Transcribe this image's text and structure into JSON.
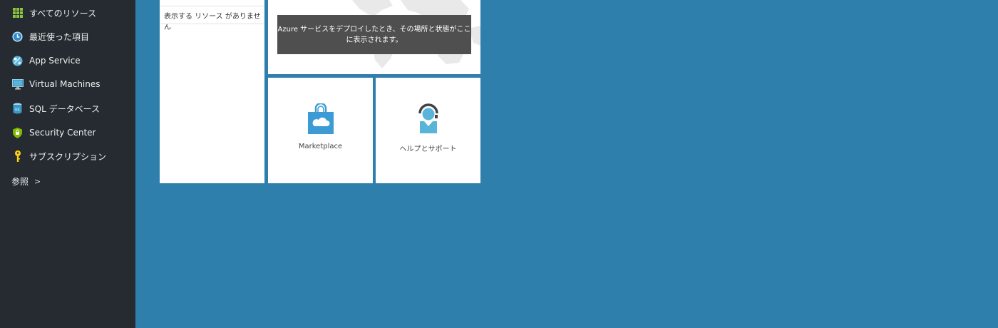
{
  "sidebar": {
    "items": [
      {
        "label": "すべてのリソース",
        "icon": "grid-icon"
      },
      {
        "label": "最近使った項目",
        "icon": "clock-icon"
      },
      {
        "label": "App Service",
        "icon": "app-service-icon"
      },
      {
        "label": "Virtual Machines",
        "icon": "monitor-icon"
      },
      {
        "label": "SQL データベース",
        "icon": "sql-database-icon"
      },
      {
        "label": "Security Center",
        "icon": "shield-icon"
      },
      {
        "label": "サブスクリプション",
        "icon": "key-icon"
      }
    ],
    "browse_label": "参照",
    "browse_chevron": ">"
  },
  "resources_tile": {
    "empty_text": "表示する リソース がありません"
  },
  "map_tile": {
    "message": "Azure サービスをデプロイしたとき、その場所と状態がここに表示されます。"
  },
  "marketplace_tile": {
    "label": "Marketplace",
    "icon": "shopping-bag-icon"
  },
  "help_tile": {
    "label": "ヘルプとサポート",
    "icon": "support-agent-icon"
  },
  "colors": {
    "sidebar_bg": "#252b31",
    "canvas_bg": "#2f7fad",
    "tile_bg": "#ffffff",
    "accent_blue": "#3c9bd5"
  }
}
